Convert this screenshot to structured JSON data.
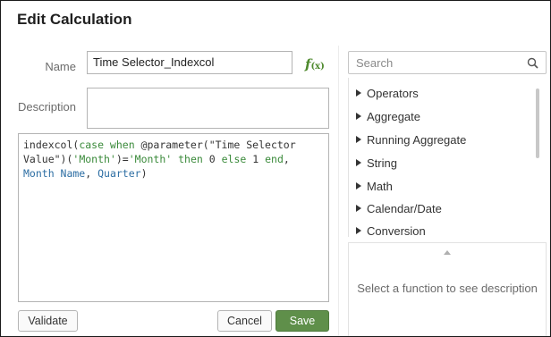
{
  "dialog": {
    "title": "Edit Calculation"
  },
  "form": {
    "name_label": "Name",
    "name_value": "Time Selector_Indexcol",
    "description_label": "Description",
    "description_value": "",
    "fx_icon": "function-icon",
    "expression": {
      "p1": "indexcol(",
      "p2": "case when",
      "p3": " @parameter(\"Time Selector\nValue\")(",
      "p4": "'Month'",
      "p5": ")=",
      "p6": "'Month'",
      "p7": " ",
      "p8": "then",
      "p9": " 0 ",
      "p10": "else",
      "p11": " 1 ",
      "p12": "end",
      "p13": ",\n",
      "p14": "Month Name",
      "p15": ", ",
      "p16": "Quarter",
      "p17": ")"
    }
  },
  "buttons": {
    "validate": "Validate",
    "cancel": "Cancel",
    "save": "Save"
  },
  "search": {
    "placeholder": "Search",
    "icon": "search-icon"
  },
  "functions": {
    "items": [
      {
        "label": "Operators"
      },
      {
        "label": "Aggregate"
      },
      {
        "label": "Running Aggregate"
      },
      {
        "label": "String"
      },
      {
        "label": "Math"
      },
      {
        "label": "Calendar/Date"
      },
      {
        "label": "Conversion"
      }
    ]
  },
  "description_panel": {
    "message": "Select a function to see description"
  },
  "colors": {
    "save_button": "#5f8f4a",
    "fx_icon": "#4f8a2e",
    "column_ref": "#2d6ea3",
    "keyword": "#3a8a3a"
  }
}
